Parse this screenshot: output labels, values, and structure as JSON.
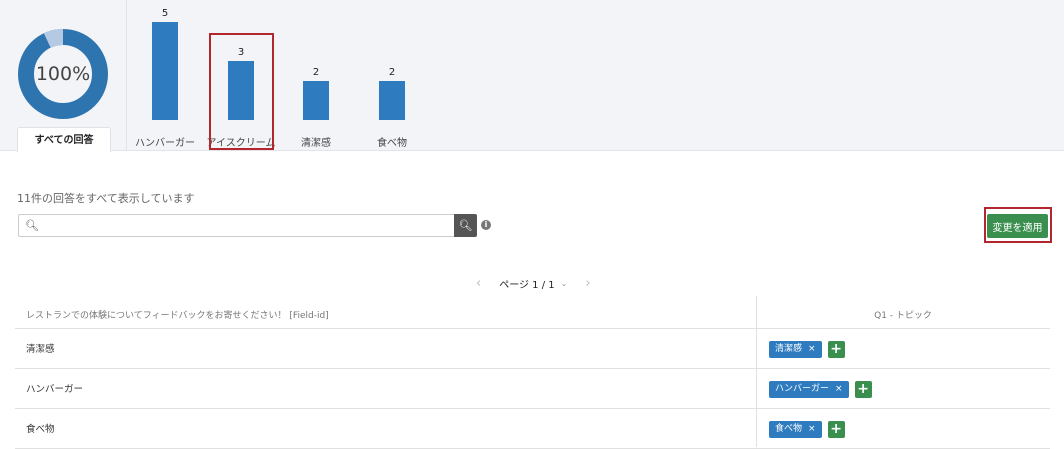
{
  "donut": {
    "label": "100%",
    "fraction": 0.93,
    "colors": {
      "main": "#2e75b0",
      "rest": "#b5c9e3"
    }
  },
  "tabs": {
    "all": "すべての回答"
  },
  "chart_data": {
    "type": "bar",
    "categories": [
      "ハンバーガー",
      "アイスクリーム",
      "清潔感",
      "食べ物"
    ],
    "values": [
      5,
      3,
      2,
      2
    ],
    "ylim": [
      0,
      5
    ],
    "color": "#2e7bbf"
  },
  "summary": "11件の回答をすべて表示しています",
  "search": {
    "placeholder": "",
    "value": ""
  },
  "apply_label": "変更を適用",
  "pager": {
    "label": "ページ 1 / 1"
  },
  "table": {
    "headers": [
      "レストランでの体験についてフィードバックをお寄せください！ [Field-id]",
      "Q1 - トピック"
    ],
    "rows": [
      {
        "text": "清潔感",
        "tags": [
          "清潔感"
        ]
      },
      {
        "text": "ハンバーガー",
        "tags": [
          "ハンバーガー"
        ]
      },
      {
        "text": "食べ物",
        "tags": [
          "食べ物"
        ]
      }
    ]
  }
}
